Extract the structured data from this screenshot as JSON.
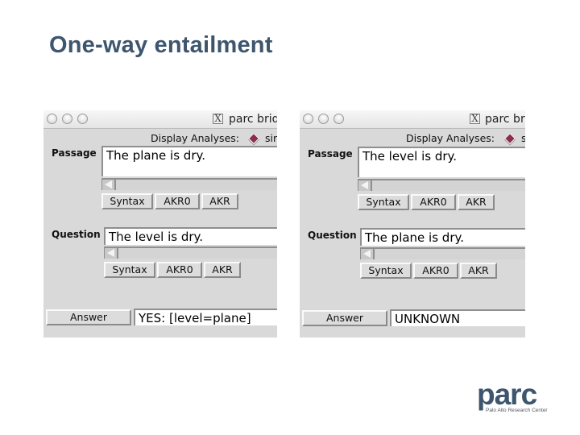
{
  "slide": {
    "title": "One-way entailment"
  },
  "windows": [
    {
      "title": "parc brid",
      "display_label": "Display Analyses:",
      "radio_label": "sir",
      "passage_label": "Passage",
      "passage_text": "The plane is dry.",
      "question_label": "Question",
      "question_text": "The level is dry.",
      "passage_buttons": [
        "Syntax",
        "AKR0",
        "AKR"
      ],
      "question_buttons": [
        "Syntax",
        "AKR0",
        "AKR"
      ],
      "answer_label": "Answer",
      "answer_text": "YES:  [level=plane]"
    },
    {
      "title": "parc bri",
      "display_label": "Display Analyses:",
      "radio_label": "s",
      "passage_label": "Passage",
      "passage_text": "The level is dry.",
      "question_label": "Question",
      "question_text": "The plane is dry.",
      "passage_buttons": [
        "Syntax",
        "AKR0",
        "AKR"
      ],
      "question_buttons": [
        "Syntax",
        "AKR0",
        "AKR"
      ],
      "answer_label": "Answer",
      "answer_text": "UNKNOWN"
    }
  ],
  "logo": {
    "word": "parc",
    "subtitle": "Palo Alto Research Center"
  }
}
